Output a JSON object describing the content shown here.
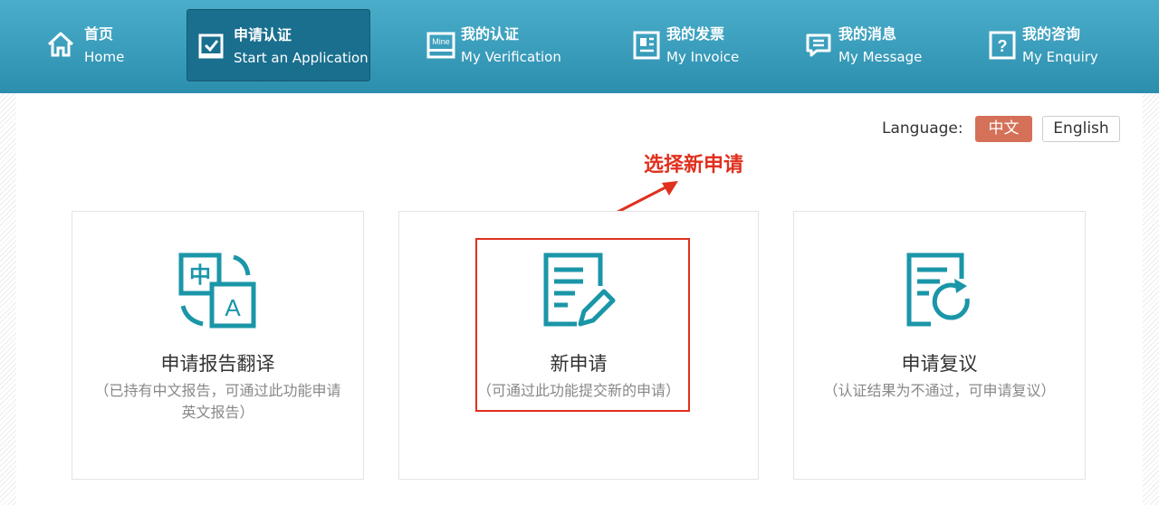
{
  "nav": {
    "items": [
      {
        "cn": "首页",
        "en": "Home",
        "icon": "home-icon"
      },
      {
        "cn": "申请认证",
        "en": "Start an Application",
        "icon": "checkbox-icon",
        "active": true
      },
      {
        "cn": "我的认证",
        "en": "My Verification",
        "icon": "mine-icon"
      },
      {
        "cn": "我的发票",
        "en": "My Invoice",
        "icon": "invoice-icon"
      },
      {
        "cn": "我的消息",
        "en": "My Message",
        "icon": "message-icon"
      },
      {
        "cn": "我的咨询",
        "en": "My Enquiry",
        "icon": "question-icon"
      }
    ]
  },
  "language": {
    "label": "Language:",
    "options": [
      "中文",
      "English"
    ],
    "selected": "中文"
  },
  "annotation": {
    "text": "选择新申请"
  },
  "cards": [
    {
      "title": "申请报告翻译",
      "subtitle": "（已持有中文报告，可通过此功能申请英文报告）",
      "icon": "translate-icon"
    },
    {
      "title": "新申请",
      "subtitle": "（可通过此功能提交新的申请）",
      "icon": "edit-document-icon"
    },
    {
      "title": "申请复议",
      "subtitle": "（认证结果为不通过，可申请复议）",
      "icon": "refresh-document-icon"
    }
  ],
  "colors": {
    "nav_top": "#4aaecb",
    "nav_bottom": "#2c8ead",
    "nav_active": "#1a6f8e",
    "accent_teal": "#1a96a8",
    "lang_selected": "#d47158",
    "annotation_red": "#e0301e"
  }
}
